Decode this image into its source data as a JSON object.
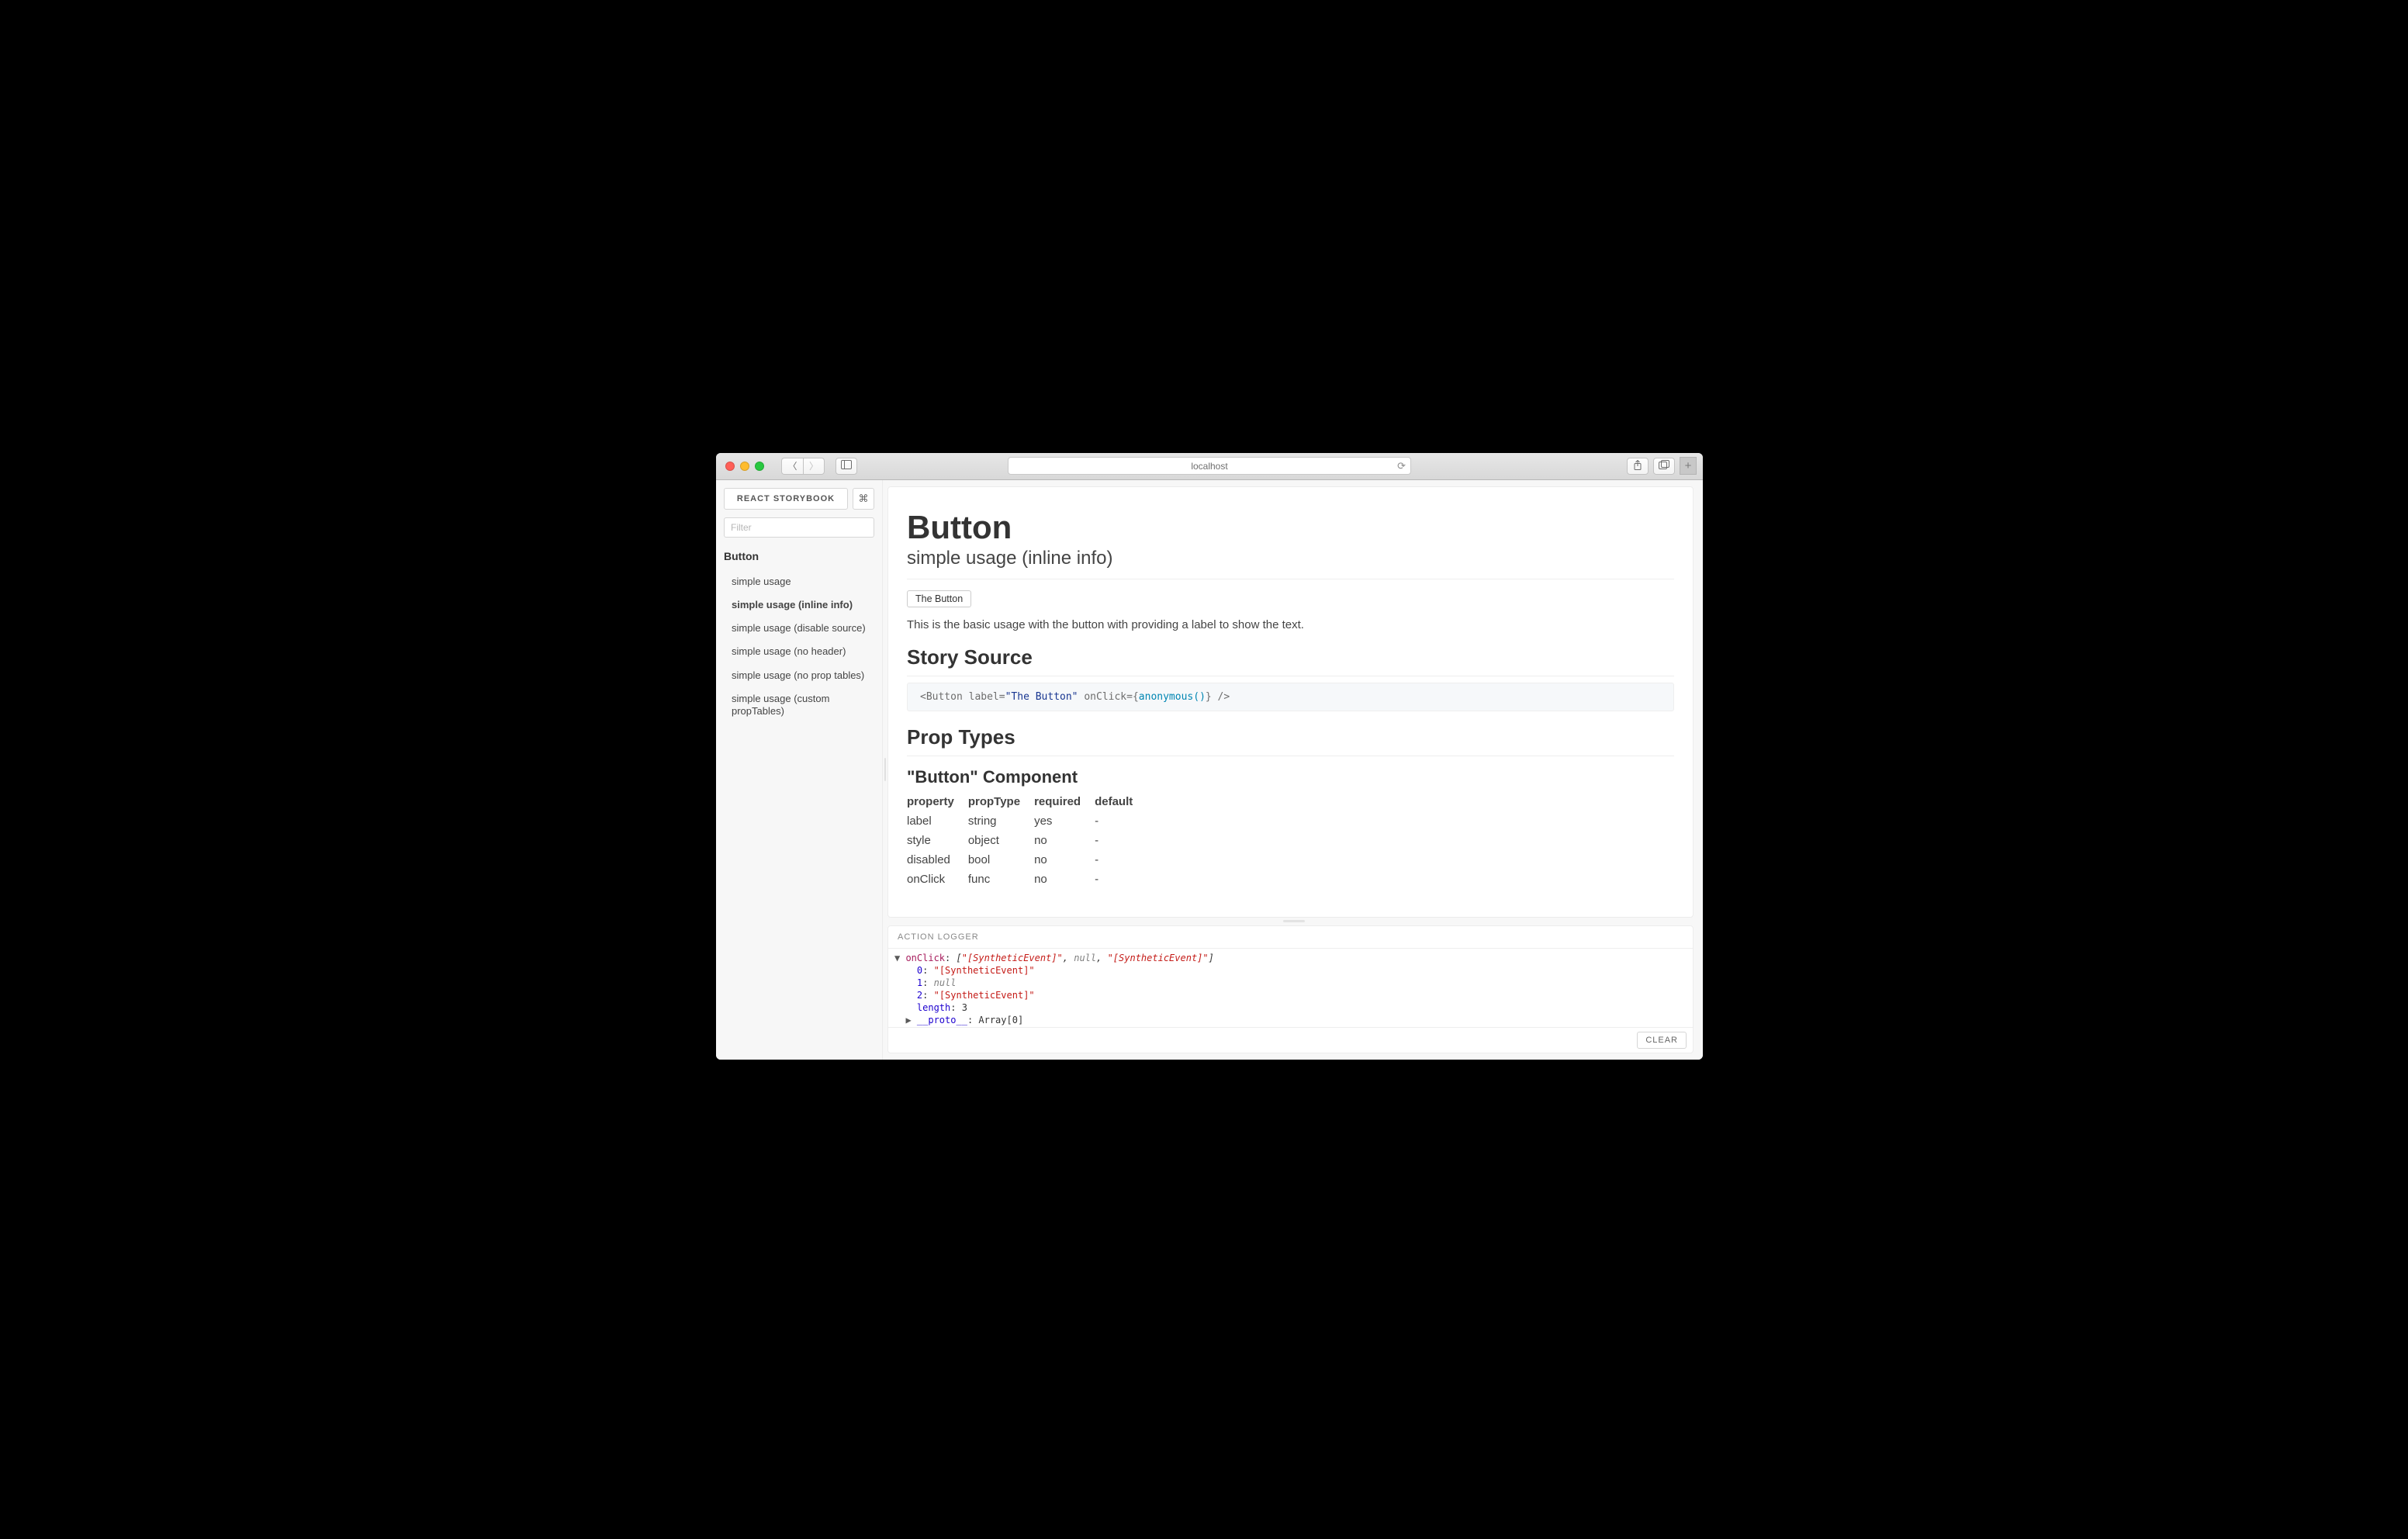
{
  "browser": {
    "url_display": "localhost"
  },
  "sidebar": {
    "title": "REACT STORYBOOK",
    "cmd_glyph": "⌘",
    "filter_placeholder": "Filter",
    "kind": "Button",
    "stories": [
      {
        "label": "simple usage",
        "selected": false
      },
      {
        "label": "simple usage (inline info)",
        "selected": true
      },
      {
        "label": "simple usage (disable source)",
        "selected": false
      },
      {
        "label": "simple usage (no header)",
        "selected": false
      },
      {
        "label": "simple usage (no prop tables)",
        "selected": false
      },
      {
        "label": "simple usage (custom propTables)",
        "selected": false
      }
    ]
  },
  "preview": {
    "component_name": "Button",
    "story_name": "simple usage (inline info)",
    "demo_button_label": "The Button",
    "description": "This is the basic usage with the button with providing a label to show the text.",
    "source_heading": "Story Source",
    "source_code": {
      "tag": "Button",
      "attr_label": "label",
      "val_label": "\"The Button\"",
      "attr_onclick": "onClick",
      "val_onclick": "anonymous()"
    },
    "proptypes_heading": "Prop Types",
    "component_heading": "\"Button\" Component",
    "prop_table": {
      "headers": [
        "property",
        "propType",
        "required",
        "default"
      ],
      "rows": [
        [
          "label",
          "string",
          "yes",
          "-"
        ],
        [
          "style",
          "object",
          "no",
          "-"
        ],
        [
          "disabled",
          "bool",
          "no",
          "-"
        ],
        [
          "onClick",
          "func",
          "no",
          "-"
        ]
      ]
    }
  },
  "logger": {
    "heading": "ACTION LOGGER",
    "clear_label": "CLEAR",
    "entry": {
      "event_name": "onClick",
      "array_repr": "[\"[SyntheticEvent]\", null, \"[SyntheticEvent]\"]",
      "items": [
        {
          "idx": "0",
          "val": "\"[SyntheticEvent]\"",
          "kind": "str"
        },
        {
          "idx": "1",
          "val": "null",
          "kind": "null"
        },
        {
          "idx": "2",
          "val": "\"[SyntheticEvent]\"",
          "kind": "str"
        }
      ],
      "length_label": "length",
      "length_value": "3",
      "proto_label": "__proto__",
      "proto_value": "Array[0]"
    }
  }
}
